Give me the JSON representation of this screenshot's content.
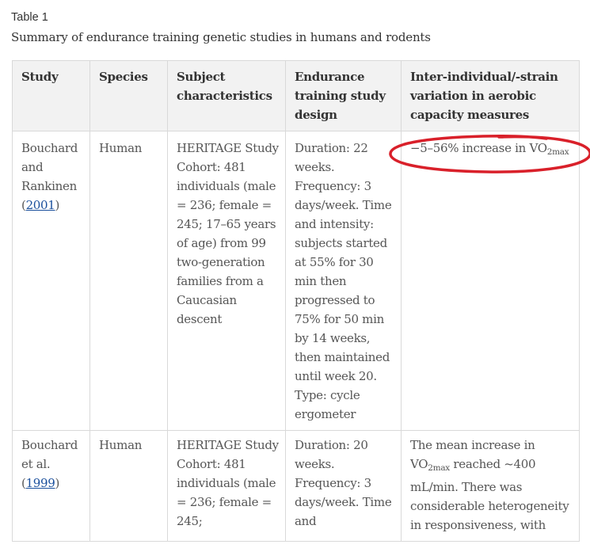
{
  "caption": {
    "label": "Table 1",
    "title": "Summary of endurance training genetic studies in humans and rodents"
  },
  "table": {
    "headers": [
      "Study",
      "Species",
      "Subject characteristics",
      "Endurance training study design",
      "Inter-individual/-strain variation in aerobic capacity measures"
    ],
    "rows": [
      {
        "study_author": "Bouchard and Rankinen (",
        "study_ref": "2001",
        "study_close": ")",
        "species": "Human",
        "subjects": "HERITAGE Study Cohort: 481 individuals (male = 236; female = 245; 17–65 years of age) from 99 two-generation families from a Caucasian descent",
        "design": "Duration: 22 weeks. Frequency: 3 days/week. Time and intensity: subjects started at 55% for 30 min then progressed to 75% for 50 min by 14 weeks, then maintained until week 20. Type: cycle ergometer",
        "variation_pre": "−5–56% increase in VO",
        "variation_sub": "2max",
        "variation_post": ""
      },
      {
        "study_author": "Bouchard et al. (",
        "study_ref": "1999",
        "study_close": ")",
        "species": "Human",
        "subjects": "HERITAGE Study Cohort: 481 individuals (male = 236; female = 245;",
        "design": "Duration: 20 weeks. Frequency: 3 days/week. Time and",
        "variation_pre": "The mean increase in VO",
        "variation_sub": "2max",
        "variation_post": " reached ~400 mL/min. There was considerable heterogeneity in responsiveness, with"
      }
    ]
  },
  "annotation": {
    "color": "#d9202a"
  }
}
